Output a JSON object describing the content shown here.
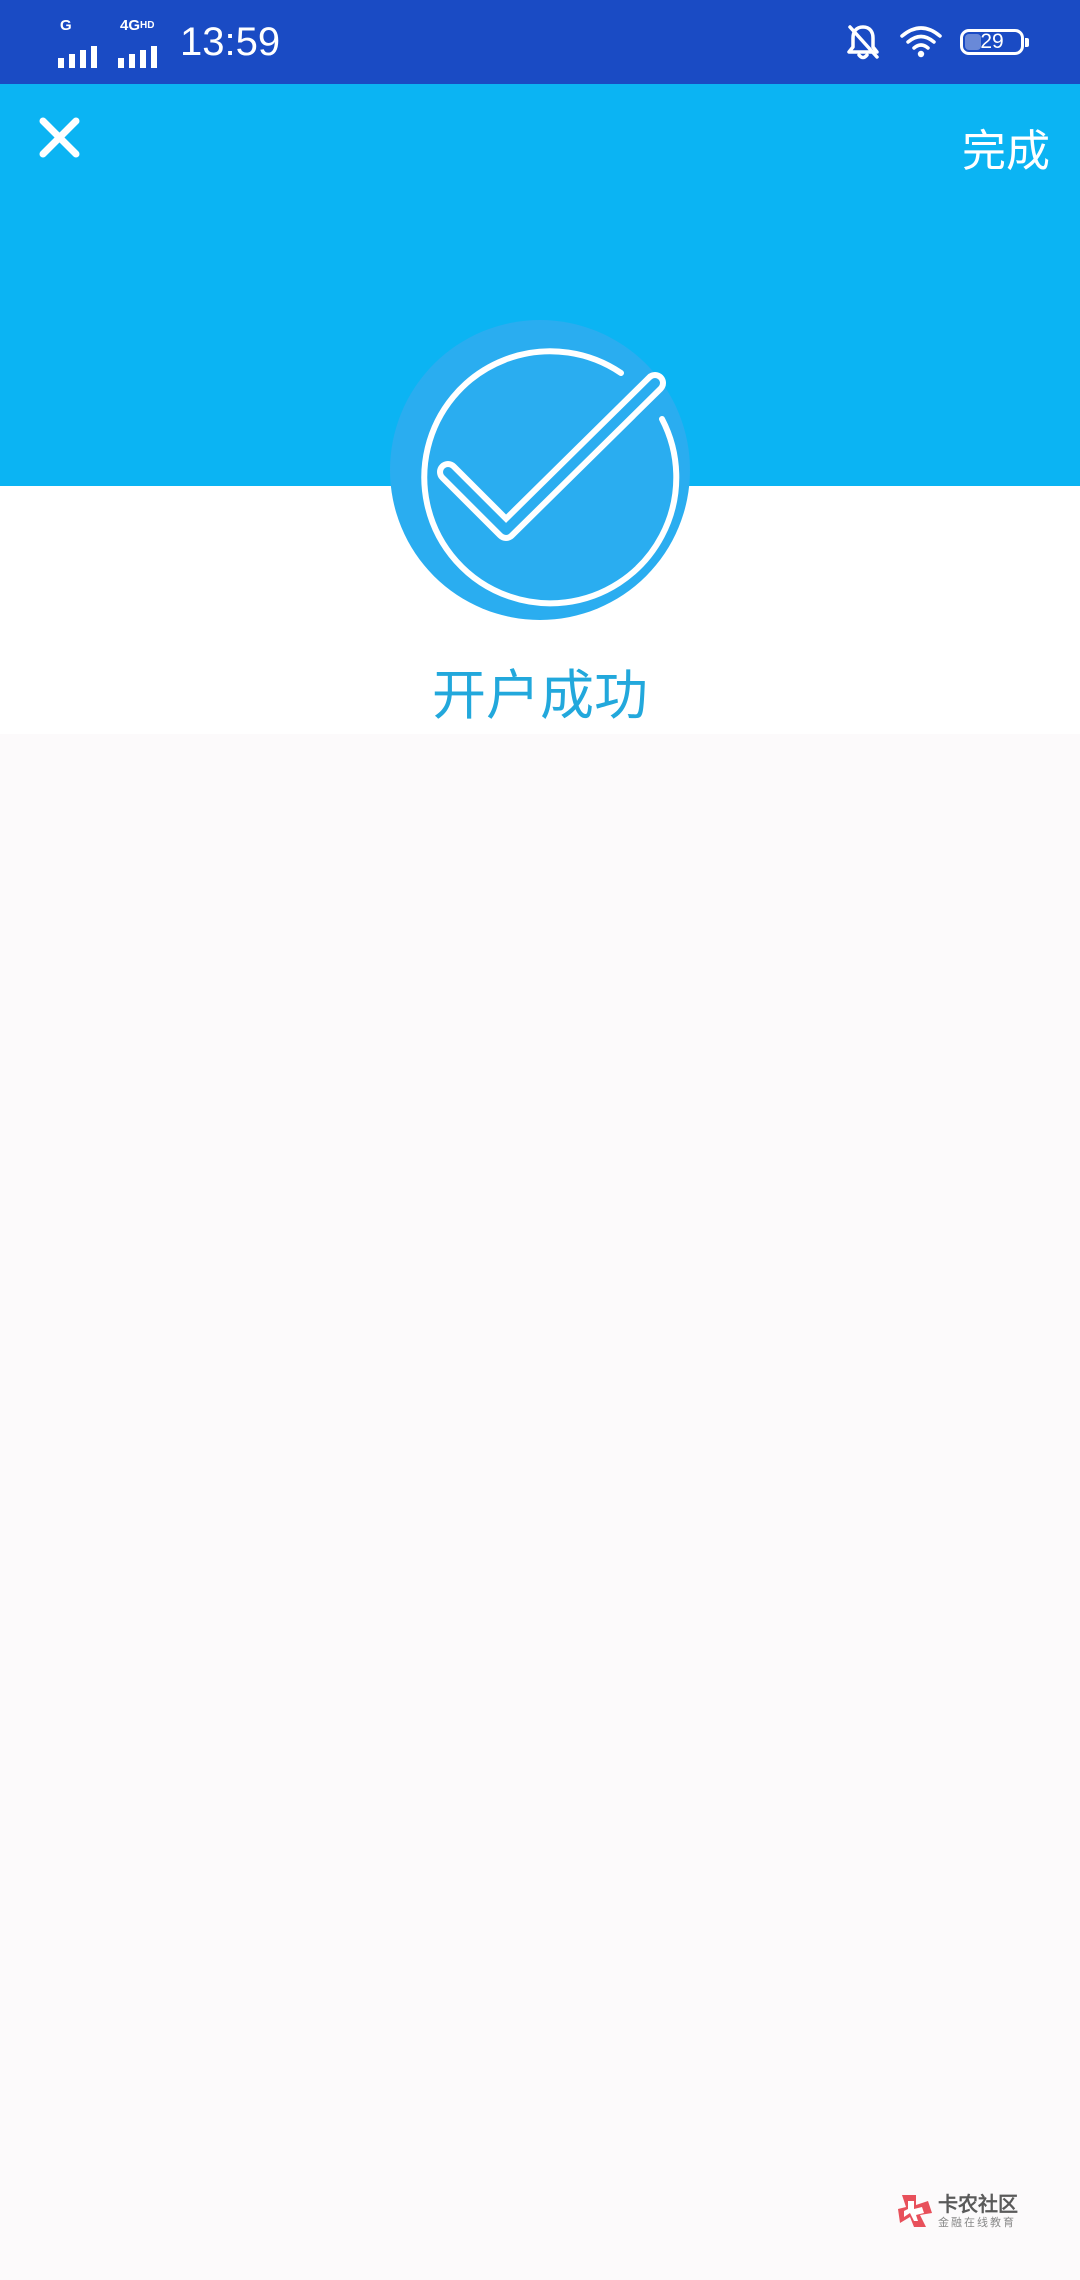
{
  "status_bar": {
    "sim1_label": "G",
    "sim2_label": "4G",
    "sim2_badge": "HD",
    "time": "13:59",
    "battery_level": "29",
    "battery_fraction": 0.29,
    "icons": [
      "signal-icon",
      "mute-bell-icon",
      "wifi-icon",
      "battery-icon"
    ]
  },
  "header": {
    "close_icon": "close-icon",
    "done_label": "完成",
    "background_color": "#0bb4f3"
  },
  "success": {
    "icon": "check-circle-icon",
    "title": "开户成功",
    "title_color": "#22a8dc"
  },
  "watermark": {
    "title": "卡农社区",
    "subtitle": "金融在线教育"
  }
}
